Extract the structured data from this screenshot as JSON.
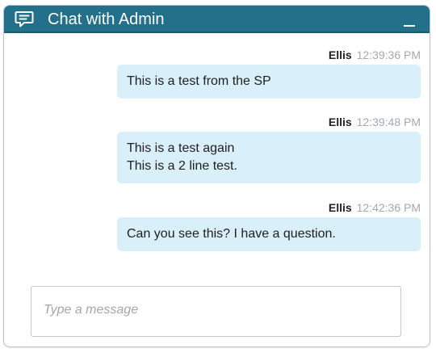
{
  "header": {
    "title": "Chat with Admin",
    "icon": "chat-bubble-icon",
    "minimize_icon": "minimize-icon",
    "background_color": "#22708a"
  },
  "messages": [
    {
      "sender": "Ellis",
      "time": "12:39:36 PM",
      "lines": [
        "This is a test from the SP"
      ]
    },
    {
      "sender": "Ellis",
      "time": "12:39:48 PM",
      "lines": [
        "This is a test again",
        "This is a 2 line test."
      ]
    },
    {
      "sender": "Ellis",
      "time": "12:42:36 PM",
      "lines": [
        "Can you see this? I have a question."
      ]
    }
  ],
  "bubble_color": "#d9effa",
  "composer": {
    "placeholder": "Type a message",
    "value": ""
  }
}
